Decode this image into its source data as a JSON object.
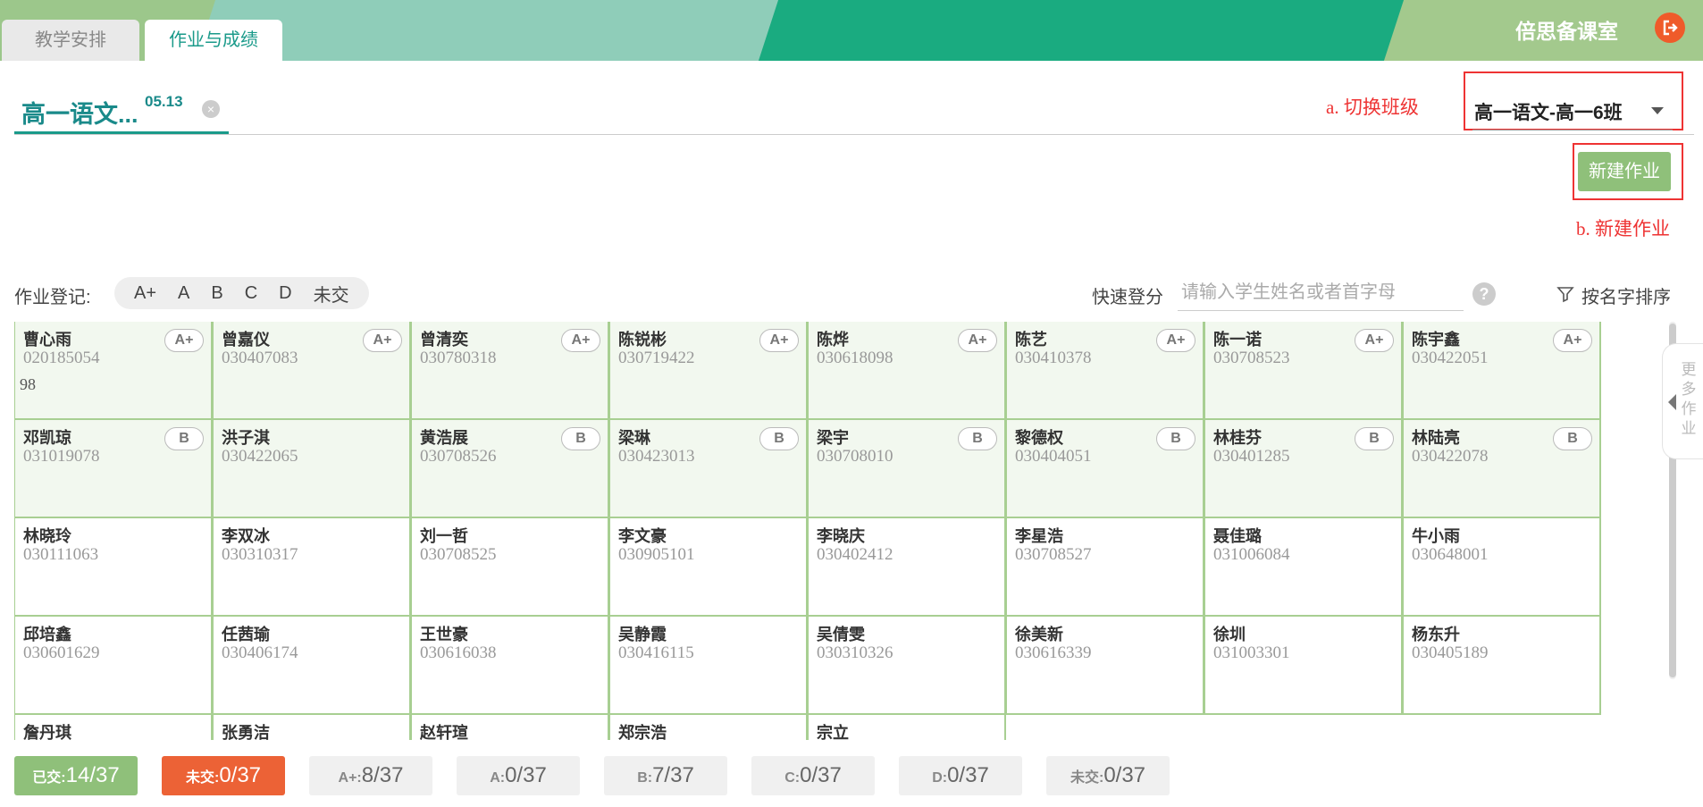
{
  "header": {
    "tabs": [
      {
        "label": "教学安排",
        "active": false
      },
      {
        "label": "作业与成绩",
        "active": true
      }
    ],
    "brand": "倍思备课室",
    "logout_icon": "logout-icon",
    "accent_color": "#1aab80"
  },
  "course": {
    "name": "高一语文...",
    "date": "05.13"
  },
  "annotations": {
    "switch_class": "a. 切换班级",
    "new_homework": "b. 新建作业"
  },
  "class_select": {
    "value": "高一语文-高一6班"
  },
  "new_button_label": "新建作业",
  "filter": {
    "register_label": "作业登记:",
    "grades": [
      "A+",
      "A",
      "B",
      "C",
      "D",
      "未交"
    ],
    "quick_label": "快速登分",
    "quick_placeholder": "请输入学生姓名或者首字母",
    "sort_label": "按名字排序"
  },
  "more_panel": "更多作业",
  "students": [
    {
      "name": "曹心雨",
      "id": "020185054",
      "grade": "A+",
      "extra": "98"
    },
    {
      "name": "曾嘉仪",
      "id": "030407083",
      "grade": "A+"
    },
    {
      "name": "曾清奕",
      "id": "030780318",
      "grade": "A+"
    },
    {
      "name": "陈锐彬",
      "id": "030719422",
      "grade": "A+"
    },
    {
      "name": "陈烨",
      "id": "030618098",
      "grade": "A+"
    },
    {
      "name": "陈艺",
      "id": "030410378",
      "grade": "A+"
    },
    {
      "name": "陈一诺",
      "id": "030708523",
      "grade": "A+"
    },
    {
      "name": "陈宇鑫",
      "id": "030422051",
      "grade": "A+"
    },
    {
      "name": "邓凯琼",
      "id": "031019078",
      "grade": "B"
    },
    {
      "name": "洪子淇",
      "id": "030422065",
      "grade": ""
    },
    {
      "name": "黄浩展",
      "id": "030708526",
      "grade": "B"
    },
    {
      "name": "梁琳",
      "id": "030423013",
      "grade": "B"
    },
    {
      "name": "梁宇",
      "id": "030708010",
      "grade": "B"
    },
    {
      "name": "黎德权",
      "id": "030404051",
      "grade": "B"
    },
    {
      "name": "林桂芬",
      "id": "030401285",
      "grade": "B"
    },
    {
      "name": "林陆亮",
      "id": "030422078",
      "grade": "B"
    },
    {
      "name": "林晓玲",
      "id": "030111063",
      "grade": ""
    },
    {
      "name": "李双冰",
      "id": "030310317",
      "grade": ""
    },
    {
      "name": "刘一哲",
      "id": "030708525",
      "grade": ""
    },
    {
      "name": "李文豪",
      "id": "030905101",
      "grade": ""
    },
    {
      "name": "李晓庆",
      "id": "030402412",
      "grade": ""
    },
    {
      "name": "李星浩",
      "id": "030708527",
      "grade": ""
    },
    {
      "name": "聂佳璐",
      "id": "031006084",
      "grade": ""
    },
    {
      "name": "牛小雨",
      "id": "030648001",
      "grade": ""
    },
    {
      "name": "邱培鑫",
      "id": "030601629",
      "grade": ""
    },
    {
      "name": "任茜瑜",
      "id": "030406174",
      "grade": ""
    },
    {
      "name": "王世豪",
      "id": "030616038",
      "grade": ""
    },
    {
      "name": "吴静霞",
      "id": "030416115",
      "grade": ""
    },
    {
      "name": "吴倩雯",
      "id": "030310326",
      "grade": ""
    },
    {
      "name": "徐美新",
      "id": "030616339",
      "grade": ""
    },
    {
      "name": "徐圳",
      "id": "031003301",
      "grade": ""
    },
    {
      "name": "杨东升",
      "id": "030405189",
      "grade": ""
    },
    {
      "name": "詹丹琪",
      "id": "",
      "grade": ""
    },
    {
      "name": "张勇洁",
      "id": "",
      "grade": ""
    },
    {
      "name": "赵轩瑄",
      "id": "",
      "grade": ""
    },
    {
      "name": "郑宗浩",
      "id": "",
      "grade": ""
    },
    {
      "name": "宗立",
      "id": "",
      "grade": ""
    }
  ],
  "stats": [
    {
      "label": "已交:",
      "value": "14/37",
      "kind": "submitted"
    },
    {
      "label": "未交:",
      "value": "0/37",
      "kind": "missing"
    },
    {
      "label": "A+:",
      "value": "8/37",
      "kind": "plain"
    },
    {
      "label": "A:",
      "value": "0/37",
      "kind": "plain"
    },
    {
      "label": "B:",
      "value": "7/37",
      "kind": "plain"
    },
    {
      "label": "C:",
      "value": "0/37",
      "kind": "plain"
    },
    {
      "label": "D:",
      "value": "0/37",
      "kind": "plain"
    },
    {
      "label": "未交:",
      "value": "0/37",
      "kind": "plain"
    }
  ]
}
